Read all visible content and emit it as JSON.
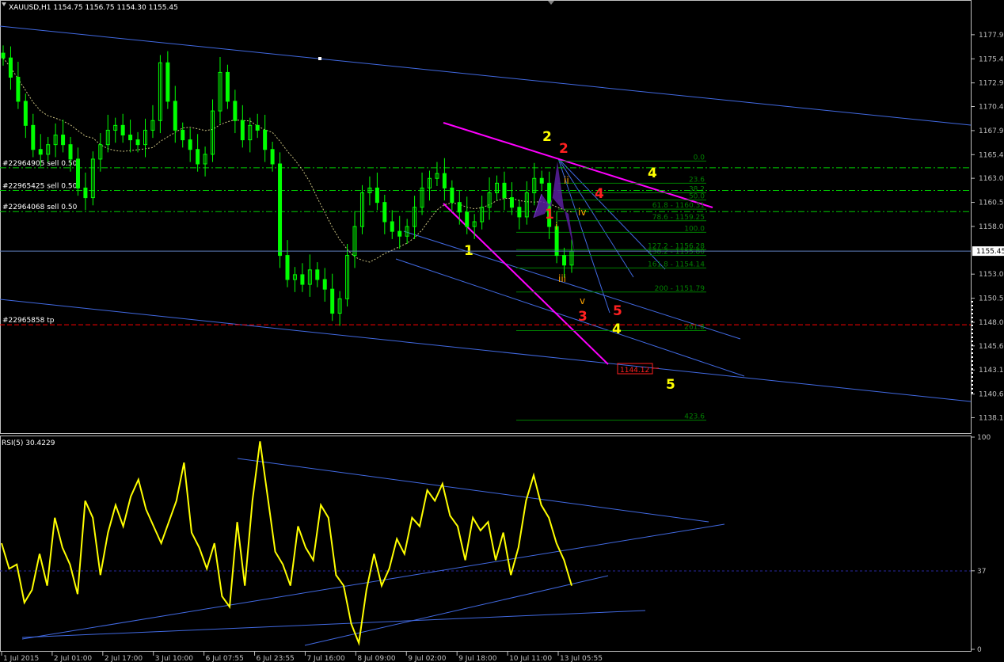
{
  "window": {
    "symbol_header": "XAUUSD,H1  1154.75 1156.75 1154.30 1155.45",
    "rsi_header": "RSI(5) 30.4229"
  },
  "colors": {
    "background": "#000000",
    "frame": "#c0c0c0",
    "bull_candle": "#00ff00",
    "bear_candle": "#90ee90",
    "trendline": "#4169e1",
    "magenta": "#ff00ff",
    "fib": "#008000",
    "order_line": "#00cc00",
    "tp_line": "#ff0000",
    "wave_yellow": "#ffff00",
    "wave_red": "#ff0000",
    "wave_orange": "#ffa500",
    "pattern_fill": "#5b20a0",
    "rsi_line": "#ffff00",
    "rsi_level": "#2828a0"
  },
  "orders": [
    {
      "label": "#22964905 sell 0.50",
      "price": 1164.1
    },
    {
      "label": "#22965425 sell 0.50",
      "price": 1161.75
    },
    {
      "label": "#22964068 sell 0.50",
      "price": 1159.55
    },
    {
      "label": "#22965858 tp",
      "price": 1147.8
    }
  ],
  "price_marker": "1144.12",
  "waves": {
    "yellow": [
      "1",
      "2",
      "4",
      "4",
      "5"
    ],
    "red": [
      "1",
      "2",
      "3",
      "4",
      "5"
    ],
    "roman": [
      "i",
      "ii",
      "iii",
      "iv",
      "v"
    ]
  },
  "fib_levels": [
    {
      "label": "0.0",
      "price": 1164.8
    },
    {
      "label": "23.6",
      "price": 1162.5
    },
    {
      "label": "38.2",
      "price": 1161.5
    },
    {
      "label": "50.0",
      "price": 1160.75
    },
    {
      "label": "61.8 - 1160.31",
      "price": 1159.8
    },
    {
      "label": "78.6 - 1159.25",
      "price": 1158.6
    },
    {
      "label": "100.0",
      "price": 1157.4
    },
    {
      "label": "127.2 - 1156.28",
      "price": 1155.6
    },
    {
      "label": "138.2 - 1155.80",
      "price": 1155.0
    },
    {
      "label": "161.8 - 1154.14",
      "price": 1153.7
    },
    {
      "label": "200 - 1151.79",
      "price": 1151.2
    },
    {
      "label": "261.8",
      "price": 1147.2
    },
    {
      "label": "423.6",
      "price": 1137.9
    }
  ],
  "chart_data": [
    {
      "type": "line",
      "title": "XAUUSD,H1  1154.75 1156.75 1154.30 1155.45",
      "series": [
        {
          "name": "XAUUSD,H1",
          "values": [
            1175.5,
            1173.5,
            1171.0,
            1168.5,
            1166.0,
            1165.5,
            1166.5,
            1167.5,
            1166.5,
            1165.0,
            1162.0,
            1161.0,
            1165.0,
            1166.5,
            1168.0,
            1168.5,
            1167.5,
            1167.0,
            1166.5,
            1168.0,
            1169.0,
            1175.0,
            1171.0,
            1168.0,
            1167.0,
            1166.0,
            1164.5,
            1165.5,
            1170.0,
            1174.0,
            1171.0,
            1169.0,
            1167.0,
            1168.5,
            1168.0,
            1166.0,
            1164.5,
            1155.0,
            1152.5,
            1153.0,
            1152.0,
            1153.5,
            1152.5,
            1151.5,
            1149.0,
            1150.5,
            1155.0,
            1158.0,
            1161.5,
            1162.0,
            1160.5,
            1158.5,
            1157.5,
            1157.0,
            1158.0,
            1160.0,
            1162.0,
            1163.0,
            1163.5,
            1162.0,
            1160.5,
            1159.5,
            1158.0,
            1158.5,
            1160.0,
            1161.5,
            1162.5,
            1161.0,
            1160.0,
            1159.0,
            1161.5,
            1163.0,
            1162.5,
            1158.0,
            1155.0,
            1154.0,
            1155.45
          ]
        }
      ],
      "ylim": [
        1136.8,
        1180.2
      ],
      "y_ticks": [
        "1177.91",
        "1175.41",
        "1172.91",
        "1170.46",
        "1167.96",
        "1165.46",
        "1163.01",
        "1160.51",
        "1158.01",
        "1155.45",
        "1153.06",
        "1150.56",
        "1148.06",
        "1145.61",
        "1143.11",
        "1140.61",
        "1138.16"
      ],
      "current_price": "1155.45"
    },
    {
      "type": "line",
      "title": "RSI(5) 30.4229",
      "series": [
        {
          "name": "RSI(5)",
          "values": [
            50,
            38,
            40,
            22,
            28,
            45,
            30,
            62,
            48,
            40,
            26,
            70,
            62,
            35,
            55,
            68,
            58,
            72,
            80,
            66,
            58,
            50,
            60,
            70,
            88,
            55,
            48,
            38,
            50,
            25,
            20,
            60,
            30,
            70,
            98,
            72,
            46,
            40,
            30,
            58,
            48,
            42,
            68,
            62,
            35,
            30,
            12,
            3,
            28,
            45,
            30,
            38,
            52,
            45,
            62,
            58,
            75,
            70,
            78,
            63,
            58,
            42,
            62,
            56,
            60,
            42,
            55,
            35,
            48,
            70,
            82,
            68,
            62,
            50,
            42,
            30
          ]
        }
      ],
      "ylim": [
        0,
        100
      ],
      "y_ticks": [
        "100",
        "37",
        "0"
      ],
      "level": 37,
      "x_ticks": [
        "1 Jul 2015",
        "2 Jul 01:00",
        "2 Jul 17:00",
        "3 Jul 10:00",
        "6 Jul 07:55",
        "6 Jul 23:55",
        "7 Jul 16:00",
        "8 Jul 09:00",
        "9 Jul 02:00",
        "9 Jul 18:00",
        "10 Jul 11:00",
        "13 Jul 05:55"
      ]
    }
  ]
}
